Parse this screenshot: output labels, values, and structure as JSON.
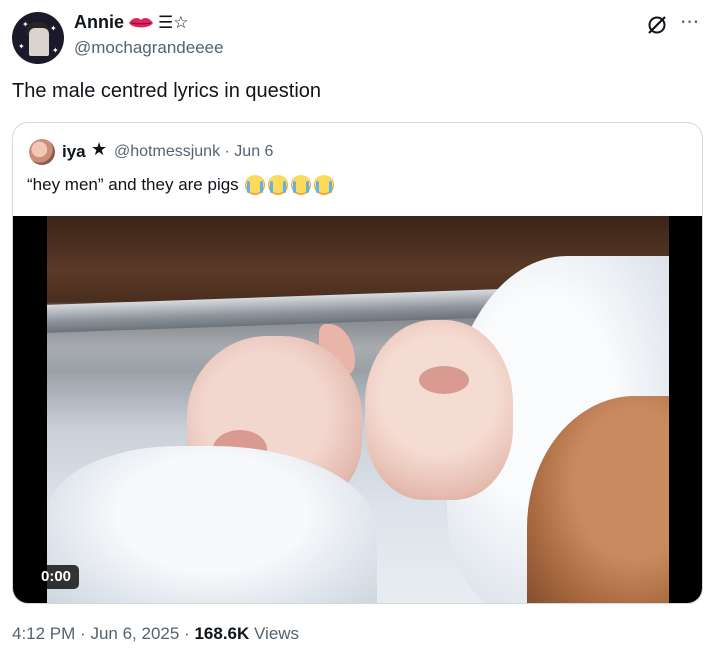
{
  "author": {
    "display_name": "Annie",
    "name_emoji_icons": [
      "lips-icon",
      "hamburger-menu-icon",
      "star-outline-icon"
    ],
    "trail_text": "☰☆",
    "handle": "@mochagrandeeee"
  },
  "header_icons": {
    "grok": "grok-icon",
    "more": "···"
  },
  "tweet": {
    "text": "The male centred lyrics in question"
  },
  "quoted_tweet": {
    "display_name": "iya",
    "star": "★",
    "handle": "@hotmessjunk",
    "separator": "·",
    "date": "Jun 6",
    "text": "“hey men” and they are pigs",
    "emoji": [
      "loudly-crying-face-icon",
      "loudly-crying-face-icon",
      "loudly-crying-face-icon",
      "loudly-crying-face-icon"
    ],
    "video": {
      "time": "0:00"
    }
  },
  "meta": {
    "time": "4:12 PM",
    "sep1": "·",
    "date": "Jun 6, 2025",
    "sep2": "·",
    "views_count": "168.6K",
    "views_label": "Views"
  },
  "colors": {
    "text": "#0f1419",
    "secondary": "#536471",
    "border": "#cfd9de",
    "lips": "#e0245e"
  }
}
